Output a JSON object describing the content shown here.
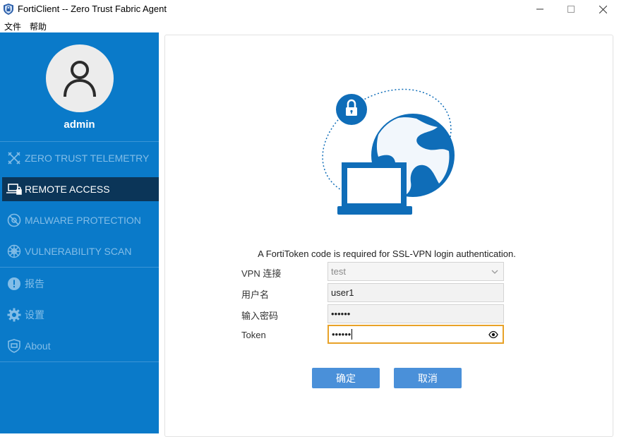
{
  "window": {
    "title": "FortiClient -- Zero Trust Fabric Agent",
    "minimize_icon": "minimize-icon",
    "maximize_icon": "maximize-icon",
    "close_icon": "close-icon"
  },
  "menu": {
    "file": "文件",
    "help": "帮助"
  },
  "sidebar": {
    "username": "admin",
    "items": [
      {
        "label": "ZERO TRUST TELEMETRY",
        "icon": "telemetry-icon"
      },
      {
        "label": "REMOTE ACCESS",
        "icon": "laptop-lock-icon",
        "active": true
      },
      {
        "label": "MALWARE PROTECTION",
        "icon": "malware-icon"
      },
      {
        "label": "VULNERABILITY SCAN",
        "icon": "vulnerability-icon"
      },
      {
        "label": "报告",
        "icon": "alert-icon"
      },
      {
        "label": "设置",
        "icon": "gear-icon"
      },
      {
        "label": "About",
        "icon": "shield-icon"
      }
    ]
  },
  "main": {
    "notice": "A FortiToken code is required for SSL-VPN login authentication.",
    "form": {
      "vpn_label": "VPN 连接",
      "vpn_value": "test",
      "username_label": "用户名",
      "username_value": "user1",
      "password_label": "输入密码",
      "password_value": "••••••",
      "token_label": "Token",
      "token_value": "••••••"
    },
    "buttons": {
      "ok": "确定",
      "cancel": "取消"
    }
  },
  "colors": {
    "sidebar": "#0a7ac9",
    "active_nav": "#0b3558",
    "button": "#4a90d9",
    "focus": "#e8a228",
    "illustration": "#0f6db8"
  }
}
